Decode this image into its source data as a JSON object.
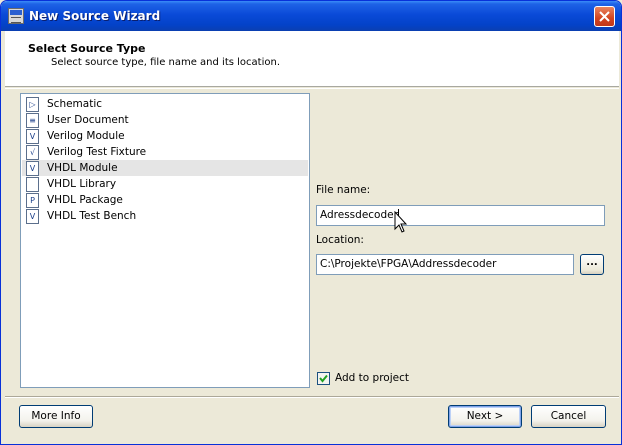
{
  "window": {
    "title": "New Source Wizard",
    "app_icon": "ise-app-icon",
    "close_icon": "close-icon"
  },
  "header": {
    "title": "Select Source Type",
    "subtitle": "Select source type, file name and its location."
  },
  "source_types": [
    {
      "label": "Schematic",
      "icon": "schematic-icon",
      "glyph": "▷"
    },
    {
      "label": "User Document",
      "icon": "document-icon",
      "glyph": "≡"
    },
    {
      "label": "Verilog Module",
      "icon": "verilog-module-icon",
      "glyph": "V"
    },
    {
      "label": "Verilog Test Fixture",
      "icon": "verilog-test-fixture-icon",
      "glyph": "√"
    },
    {
      "label": "VHDL Module",
      "icon": "vhdl-module-icon",
      "glyph": "V"
    },
    {
      "label": "VHDL Library",
      "icon": "vhdl-library-icon",
      "glyph": ""
    },
    {
      "label": "VHDL Package",
      "icon": "vhdl-package-icon",
      "glyph": "P"
    },
    {
      "label": "VHDL Test Bench",
      "icon": "vhdl-test-bench-icon",
      "glyph": "V"
    }
  ],
  "selected_index": 4,
  "form": {
    "file_name_label": "File name:",
    "file_name_value": "Adressdecoder",
    "location_label": "Location:",
    "location_value": "C:\\Projekte\\FPGA\\Addressdecoder",
    "browse_label": "...",
    "add_to_project_label": "Add to project",
    "add_to_project_checked": true
  },
  "buttons": {
    "more_info": "More Info",
    "next": "Next >",
    "cancel": "Cancel"
  },
  "colors": {
    "titlebar": "#0a4ad8",
    "selection": "#e5e5e5",
    "dialog_bg": "#ece9d8"
  }
}
